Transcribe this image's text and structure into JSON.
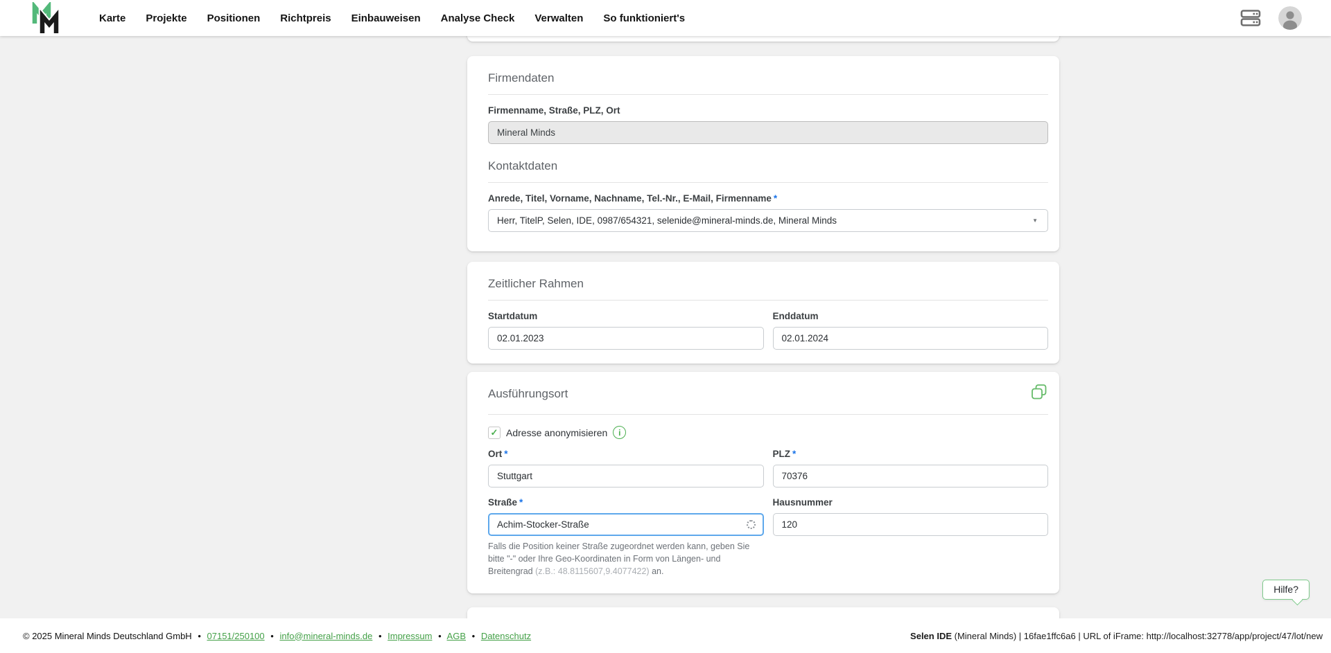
{
  "nav": {
    "items": [
      "Karte",
      "Projekte",
      "Positionen",
      "Richtpreis",
      "Einbauweisen",
      "Analyse Check",
      "Verwalten",
      "So funktioniert's"
    ]
  },
  "cards": {
    "company": {
      "section1_title": "Firmendaten",
      "company_label": "Firmenname, Straße, PLZ, Ort",
      "company_value": "Mineral Minds",
      "section2_title": "Kontaktdaten",
      "contact_label": "Anrede, Titel, Vorname, Nachname, Tel.-Nr., E-Mail, Firmenname",
      "contact_value": "Herr, TitelP, Selen, IDE, 0987/654321, selenide@mineral-minds.de, Mineral Minds"
    },
    "timeframe": {
      "title": "Zeitlicher Rahmen",
      "start_label": "Startdatum",
      "start_value": "02.01.2023",
      "end_label": "Enddatum",
      "end_value": "02.01.2024"
    },
    "location": {
      "title": "Ausführungsort",
      "anonymize_label": "Adresse anonymisieren",
      "anonymize_checked": true,
      "ort_label": "Ort",
      "ort_value": "Stuttgart",
      "plz_label": "PLZ",
      "plz_value": "70376",
      "strasse_label": "Straße",
      "strasse_value": "Achim-Stocker-Straße",
      "strasse_loading": true,
      "hausnummer_label": "Hausnummer",
      "hausnummer_value": "120",
      "helper_part1": "Falls die Position keiner Straße zugeordnet werden kann, geben Sie bitte \"-\" oder Ihre Geo-Koordinaten in Form von Längen- und Breitengrad ",
      "helper_muted": "(z.B.: 48.8115607,9.4077422)",
      "helper_part2": " an."
    }
  },
  "help_button": {
    "label": "Hilfe?"
  },
  "footer": {
    "copyright": "© 2025 Mineral Minds Deutschland GmbH",
    "links": [
      "07151/250100",
      "info@mineral-minds.de",
      "Impressum",
      "AGB",
      "Datenschutz"
    ],
    "right_bold": "Selen IDE",
    "right_rest": " (Mineral Minds) | 16fae1ffc6a6 | URL of iFrame: http://localhost:32778/app/project/47/lot/new"
  },
  "ui": {
    "required_marker": "*",
    "separator": "•"
  },
  "icons": {
    "check": "✓",
    "caret": "▼",
    "info": "i"
  },
  "colors": {
    "brand_green": "#53b97a",
    "accent_green": "#4caf50",
    "link_green": "#43a047",
    "required_blue": "#1a73e8",
    "focus_blue": "#5ea8ec",
    "page_background": "#f1f1f1"
  }
}
